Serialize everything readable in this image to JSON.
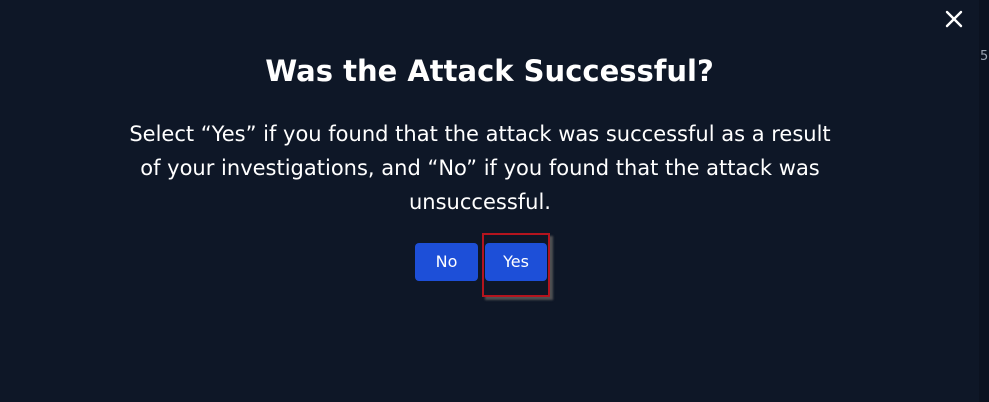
{
  "dialog": {
    "title": "Was the Attack Successful?",
    "description": "Select “Yes” if you found that the attack was successful as a result of your investigations, and “No” if you found that the attack was unsuccessful.",
    "buttons": {
      "no_label": "No",
      "yes_label": "Yes"
    },
    "close_icon": "close-icon"
  },
  "background_partial_text": "5",
  "colors": {
    "background": "#0e1727",
    "button": "#1d4fd8",
    "highlight": "#b4141e",
    "text": "#ffffff"
  }
}
